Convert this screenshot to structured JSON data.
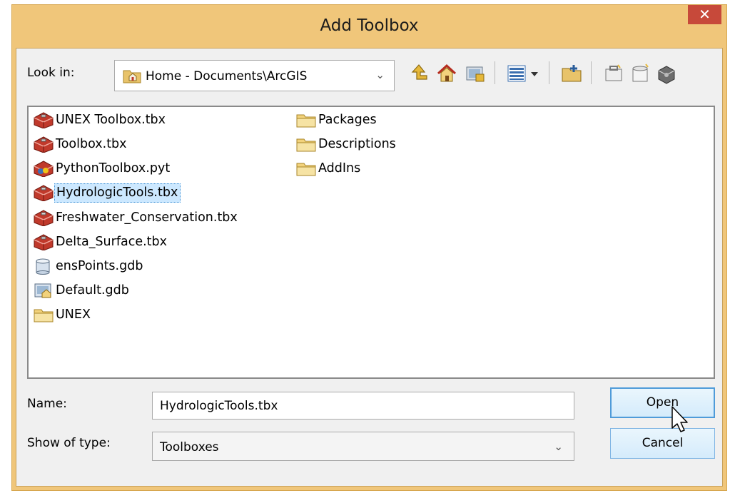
{
  "window": {
    "title": "Add Toolbox",
    "close_glyph": "✕"
  },
  "lookin": {
    "label": "Look in:",
    "value": "Home - Documents\\ArcGIS",
    "icon": "home-folder-icon"
  },
  "toolbar": {
    "icons": [
      "up-one-level-icon",
      "home-icon",
      "connect-folder-icon",
      "view-list-icon",
      "view-dropdown-icon",
      "new-folder-icon",
      "new-toolbox-icon",
      "new-item-icon",
      "new-python-toolbox-icon"
    ]
  },
  "files": [
    {
      "label": "UNEX Toolbox.tbx",
      "icon": "toolbox-icon"
    },
    {
      "label": "Toolbox.tbx",
      "icon": "toolbox-icon"
    },
    {
      "label": "PythonToolbox.pyt",
      "icon": "python-toolbox-icon"
    },
    {
      "label": "HydrologicTools.tbx",
      "icon": "toolbox-icon",
      "selected": true
    },
    {
      "label": "Freshwater_Conservation.tbx",
      "icon": "toolbox-icon"
    },
    {
      "label": "Delta_Surface.tbx",
      "icon": "toolbox-icon"
    },
    {
      "label": "ensPoints.gdb",
      "icon": "geodatabase-icon"
    },
    {
      "label": "Default.gdb",
      "icon": "home-geodatabase-icon"
    },
    {
      "label": "UNEX",
      "icon": "folder-icon"
    },
    {
      "label": "Packages",
      "icon": "folder-icon"
    },
    {
      "label": "Descriptions",
      "icon": "folder-icon"
    },
    {
      "label": "AddIns",
      "icon": "folder-icon"
    }
  ],
  "name": {
    "label": "Name:",
    "value": "HydrologicTools.tbx"
  },
  "type": {
    "label": "Show of type:",
    "value": "Toolboxes"
  },
  "buttons": {
    "open": "Open",
    "cancel": "Cancel"
  },
  "colors": {
    "titlebar": "#f0c67a",
    "close": "#c7493a",
    "selection": "#cce8ff",
    "toolbox": "#c0392b"
  }
}
